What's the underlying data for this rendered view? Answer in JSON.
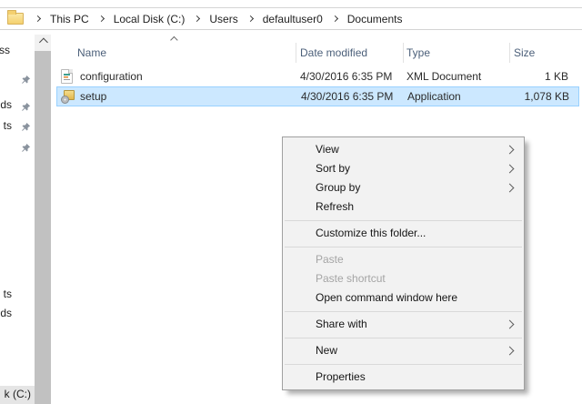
{
  "address_bar": {
    "crumbs": [
      "This PC",
      "Local Disk (C:)",
      "Users",
      "defaultuser0",
      "Documents"
    ]
  },
  "sidebar": {
    "quick_access_tail": "ss",
    "qa_downloads_tail": "ds",
    "qa_documents_tail": "ts",
    "pc_documents_tail": "ts",
    "pc_downloads_tail": "ds",
    "local_disk_tail": "k (C:)"
  },
  "file_list": {
    "columns": {
      "name": "Name",
      "date_modified": "Date modified",
      "type": "Type",
      "size": "Size"
    },
    "sort": {
      "column": "Name",
      "direction": "ascending"
    },
    "rows": [
      {
        "name": "configuration",
        "date_modified": "4/30/2016 6:35 PM",
        "type": "XML Document",
        "size": "1 KB",
        "icon": "xml-document-icon",
        "selected": false
      },
      {
        "name": "setup",
        "date_modified": "4/30/2016 6:35 PM",
        "type": "Application",
        "size": "1,078 KB",
        "icon": "application-icon",
        "selected": true
      }
    ]
  },
  "context_menu": {
    "items": [
      {
        "label": "View",
        "submenu": true
      },
      {
        "label": "Sort by",
        "submenu": true
      },
      {
        "label": "Group by",
        "submenu": true
      },
      {
        "label": "Refresh",
        "submenu": false
      },
      {
        "separator": true
      },
      {
        "label": "Customize this folder...",
        "submenu": false
      },
      {
        "separator": true
      },
      {
        "label": "Paste",
        "disabled": true
      },
      {
        "label": "Paste shortcut",
        "disabled": true
      },
      {
        "label": "Open command window here",
        "submenu": false
      },
      {
        "separator": true
      },
      {
        "label": "Share with",
        "submenu": true
      },
      {
        "separator": true
      },
      {
        "label": "New",
        "submenu": true
      },
      {
        "separator": true
      },
      {
        "label": "Properties",
        "submenu": false
      }
    ]
  },
  "colors": {
    "selection_bg": "#cce8ff",
    "selection_border": "#99d1ff",
    "menu_bg": "#f2f2f2",
    "menu_border": "#a0a0a0",
    "disabled_text": "#a5a5a5",
    "header_text": "#4c607a",
    "folder_yellow": "#f4d06f"
  }
}
